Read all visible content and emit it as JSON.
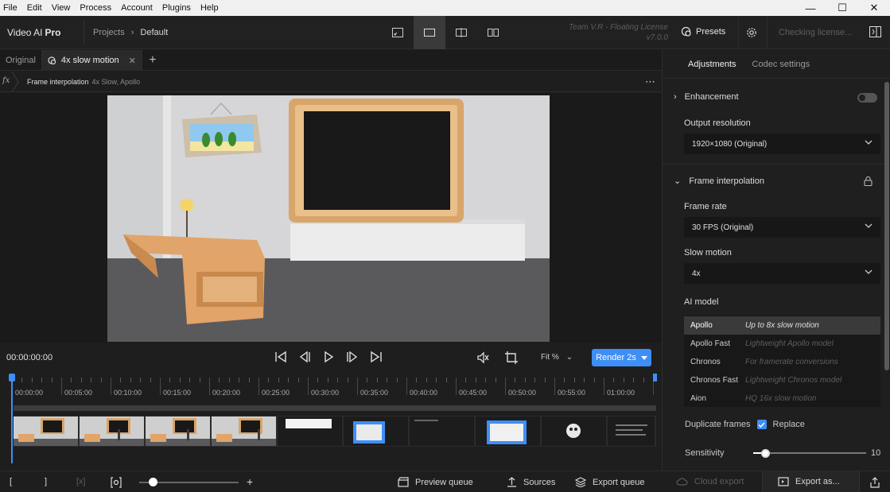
{
  "menu": [
    "File",
    "Edit",
    "View",
    "Process",
    "Account",
    "Plugins",
    "Help"
  ],
  "app": {
    "name": "Video AI",
    "edition": "Pro"
  },
  "breadcrumb": {
    "parent": "Projects",
    "current": "Default"
  },
  "license": {
    "line1": "Team V.R - Floating License",
    "line2": "v7.0.0"
  },
  "header": {
    "presets_label": "Presets",
    "checking_label": "Checking license..."
  },
  "tabs": {
    "original": "Original",
    "active": "4x slow motion"
  },
  "filter": {
    "fx": "fx",
    "name": "Frame interpolation",
    "detail": "4x Slow, Apollo"
  },
  "transport": {
    "timecode": "00:00:00:00",
    "zoom": "Fit %",
    "render_label": "Render 2s"
  },
  "ruler_labels": [
    "00:00:00",
    "00:05:00",
    "00:10:00",
    "00:15:00",
    "00:20:00",
    "00:25:00",
    "00:30:00",
    "00:35:00",
    "00:40:00",
    "00:45:00",
    "00:50:00",
    "00:55:00",
    "01:00:00"
  ],
  "bottombar": {
    "preview_queue": "Preview queue",
    "sources": "Sources",
    "export_queue": "Export queue",
    "cloud_export": "Cloud export",
    "export_as": "Export as..."
  },
  "panel": {
    "tabs": [
      "Adjustments",
      "Codec settings"
    ],
    "enhancement": "Enhancement",
    "output_resolution_label": "Output resolution",
    "output_resolution_value": "1920×1080 (Original)",
    "frame_interpolation": "Frame interpolation",
    "frame_rate_label": "Frame rate",
    "frame_rate_value": "30 FPS (Original)",
    "slow_motion_label": "Slow motion",
    "slow_motion_value": "4x",
    "ai_model_label": "AI model",
    "models": [
      {
        "name": "Apollo",
        "desc": "Up to 8x slow motion"
      },
      {
        "name": "Apollo Fast",
        "desc": "Lightweight Apollo model"
      },
      {
        "name": "Chronos",
        "desc": "For framerate conversions"
      },
      {
        "name": "Chronos Fast",
        "desc": "Lightweight Chronos model"
      },
      {
        "name": "Aion",
        "desc": "HQ 16x slow motion"
      }
    ],
    "duplicate_frames_label": "Duplicate frames",
    "replace_label": "Replace",
    "sensitivity_label": "Sensitivity",
    "sensitivity_value": "10"
  },
  "colors": {
    "accent": "#3e8ef7",
    "background": "#1e1e1e"
  }
}
